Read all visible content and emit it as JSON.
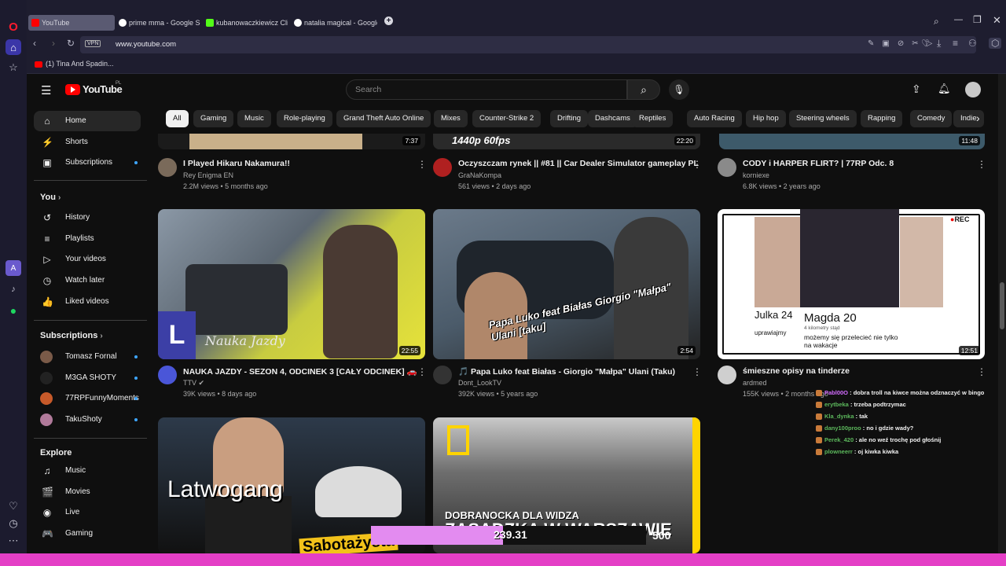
{
  "browser": {
    "tabs": [
      {
        "label": "YouTube",
        "active": true,
        "color": "#ff0000"
      },
      {
        "label": "prime mma - Google Sear",
        "active": false,
        "color": "#ffffff"
      },
      {
        "label": "kubanowaczkiewicz Clips",
        "active": false,
        "color": "#53fc18"
      },
      {
        "label": "natalia magical - Google S",
        "active": false,
        "color": "#ffffff"
      }
    ],
    "url": "www.youtube.com",
    "vpn_label": "VPN",
    "bookmark": "(1) Tina And Spadin..."
  },
  "youtube": {
    "logo_text": "YouTube",
    "region": "PL",
    "search_placeholder": "Search",
    "sidebar": {
      "main": [
        {
          "label": "Home",
          "icon": "home-icon",
          "glyph": "⌂",
          "active": true
        },
        {
          "label": "Shorts",
          "icon": "shorts-icon",
          "glyph": "⚡"
        },
        {
          "label": "Subscriptions",
          "icon": "subscriptions-icon",
          "glyph": "▣"
        }
      ],
      "you_heading": "You",
      "you": [
        {
          "label": "History",
          "icon": "history-icon",
          "glyph": "↺"
        },
        {
          "label": "Playlists",
          "icon": "playlists-icon",
          "glyph": "≡"
        },
        {
          "label": "Your videos",
          "icon": "your-videos-icon",
          "glyph": "▷"
        },
        {
          "label": "Watch later",
          "icon": "watch-later-icon",
          "glyph": "◷"
        },
        {
          "label": "Liked videos",
          "icon": "liked-icon",
          "glyph": "👍"
        }
      ],
      "subs_heading": "Subscriptions",
      "subs": [
        {
          "label": "Tomasz Fornal",
          "color": "#7a5a48"
        },
        {
          "label": "M3GA SHOTY",
          "color": "#222222"
        },
        {
          "label": "77RPFunnyMoments",
          "color": "#c75a2a"
        },
        {
          "label": "TakuShoty",
          "color": "#b07a9a"
        }
      ],
      "explore_heading": "Explore",
      "explore": [
        {
          "label": "Music",
          "icon": "music-icon",
          "glyph": "♫"
        },
        {
          "label": "Movies",
          "icon": "movies-icon",
          "glyph": "🎬"
        },
        {
          "label": "Live",
          "icon": "live-icon",
          "glyph": "◉"
        },
        {
          "label": "Gaming",
          "icon": "gaming-icon",
          "glyph": "🎮"
        }
      ]
    },
    "chips": [
      "All",
      "Gaming",
      "Music",
      "Role-playing",
      "Grand Theft Auto Online",
      "Mixes",
      "Counter-Strike 2",
      "Drifting",
      "Dashcams",
      "Reptiles",
      "Auto Racing",
      "Hip hop",
      "Steering wheels",
      "Rapping",
      "Comedy",
      "Indie"
    ],
    "row1": [
      {
        "title": "I Played Hikaru Nakamura!!",
        "channel": "Rey Enigma EN",
        "meta": "2.2M views • 5 months ago",
        "duration": "7:37",
        "thumb_text": ""
      },
      {
        "title": "Oczyszczam rynek || #81 || Car Dealer Simulator gameplay PL",
        "channel": "GraNaKompa",
        "meta": "561 views • 2 days ago",
        "duration": "22:20",
        "thumb_text": "1440p 60fps"
      },
      {
        "title": "CODY i HARPER FLIRT? | 77RP Odc. 8",
        "channel": "kornieхе",
        "meta": "6.8K views • 2 years ago",
        "duration": "11:48",
        "thumb_text": ""
      }
    ],
    "row2": [
      {
        "title": "NAUKA JAZDY - SEZON 4, ODCINEK 3 [CAŁY ODCINEK] 🚗",
        "channel": "TTV ✔",
        "meta": "39K views • 8 days ago",
        "duration": "22:55",
        "thumb_text": "Nauka Jazdy"
      },
      {
        "title": "🎵 Papa Luko feat Białas  - Giorgio \"Małpa\" Ulani (Taku)",
        "channel": "Dont_LookTV",
        "meta": "392K views • 5 years ago",
        "duration": "2:54",
        "thumb_text": "Papa Luko feat Białas Giorgio \"Małpa\" Ulani [taku]"
      },
      {
        "title": "śmieszne opisy na tinderze",
        "channel": "ardmed",
        "meta": "155K views • 2 months ago",
        "duration": "12:51",
        "thumb_text": "Magda 20",
        "rec": "REC",
        "thumb_sub": "4 kilometry stąd",
        "thumb_desc": "możemy się przelecieć nie tylko na wakacje",
        "left_name": "Julka 24",
        "left_desc": "uprawiajmy"
      }
    ],
    "row3": [
      {
        "thumb_text": "Latwogang",
        "thumb_sub": "Sabotażysta"
      },
      {
        "thumb_text": "DOBRANOCKA DLA WIDZA",
        "thumb_sub": "ZASADZKA W WARSZAWIE"
      }
    ]
  },
  "stream": {
    "chat": [
      {
        "user": "Pabl00O",
        "text": "dobra troll na kiwce można odznaczyć w bingo",
        "color": "#d36cff"
      },
      {
        "user": "erytbeka",
        "text": "trzeba podtrzymac",
        "color": "#5cb85c"
      },
      {
        "user": "Kla_dynka",
        "text": "tak",
        "color": "#5cb85c"
      },
      {
        "user": "dany100proo",
        "text": "no i gdzie wady?",
        "color": "#5cb85c"
      },
      {
        "user": "Perek_420",
        "text": "ale no weź trochę pod głośnij",
        "color": "#5cb85c"
      },
      {
        "user": "plowneerr",
        "text": "oj kiwka kiwka",
        "color": "#5cb85c"
      }
    ],
    "goal_current": "239.31",
    "goal_target": "500",
    "goal_fraction": 0.48,
    "accent": "#e43fc6"
  }
}
